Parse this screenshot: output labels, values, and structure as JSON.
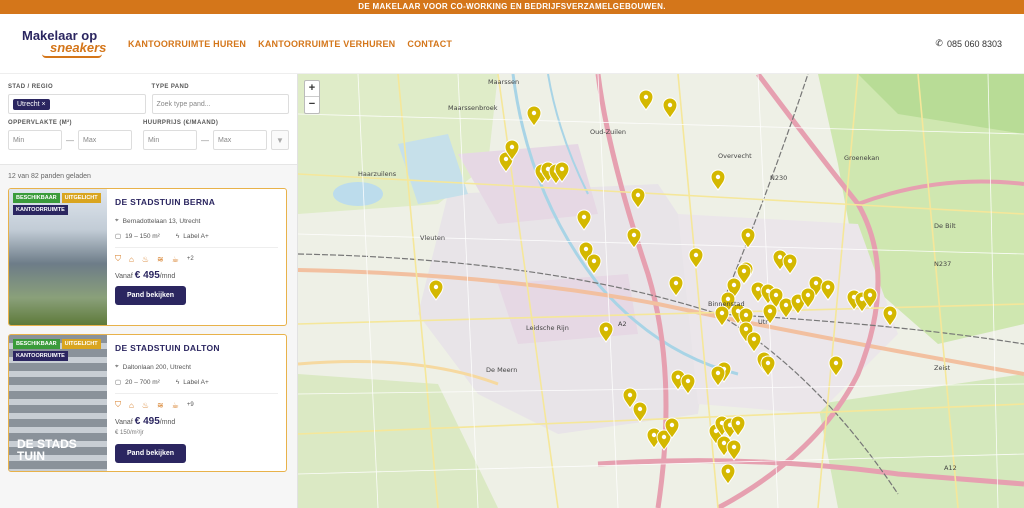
{
  "topbar": {
    "text": "DE MAKELAAR VOOR CO-WORKING EN BEDRIJFSVERZAMELGEBOUWEN."
  },
  "brand": {
    "line1": "Makelaar op",
    "line2": "sneakers"
  },
  "nav": [
    {
      "label": "KANTOORRUIMTE HUREN"
    },
    {
      "label": "KANTOORRUIMTE VERHUREN"
    },
    {
      "label": "CONTACT"
    }
  ],
  "phone": "085 060 8303",
  "filters": {
    "city_label": "STAD / REGIO",
    "city_chip": "Utrecht ×",
    "type_label": "TYPE PAND",
    "type_placeholder": "Zoek type pand...",
    "area_label": "OPPERVLAKTE (M²)",
    "area_min": "Min",
    "area_max": "Max",
    "rent_label": "HUURPRIJS (€/MAAND)",
    "rent_min": "Min",
    "rent_max": "Max"
  },
  "results_count": "12 van 82 panden geladen",
  "cards": [
    {
      "badges": [
        "BESCHIKBAAR",
        "UITGELICHT",
        "KANTOORRUIMTE"
      ],
      "title": "DE STADSTUIN BERNA",
      "address": "Bernadottelaan 13, Utrecht",
      "size": "19 – 150 m²",
      "label": "Label A+",
      "more": "+2",
      "price_prefix": "Vanaf",
      "price": "€ 495",
      "price_suffix": "/mnd",
      "sqm": "",
      "button": "Pand bekijken"
    },
    {
      "badges": [
        "BESCHIKBAAR",
        "UITGELICHT",
        "KANTOORRUIMTE"
      ],
      "title": "DE STADSTUIN DALTON",
      "address": "Daltonlaan 200, Utrecht",
      "size": "20 – 700 m²",
      "label": "Label A+",
      "more": "+9",
      "price_prefix": "Vanaf",
      "price": "€ 495",
      "price_suffix": "/mnd",
      "sqm": "€ 150/m²/jr",
      "button": "Pand bekijken",
      "image_text": "DE STADS TUIN"
    }
  ],
  "map": {
    "zoom_in": "+",
    "zoom_out": "−",
    "labels": [
      "Maarssen",
      "Maarssenbroek",
      "Oud-Zuilen",
      "Overvecht",
      "Groenekan",
      "Haarzuilens",
      "Vleuten",
      "De Bilt",
      "Leidsche Rijn",
      "De Meern",
      "Utr",
      "Binnenstad",
      "Zeist",
      "A2",
      "N230",
      "N237",
      "A12"
    ],
    "pin_color": "#d4b800"
  }
}
